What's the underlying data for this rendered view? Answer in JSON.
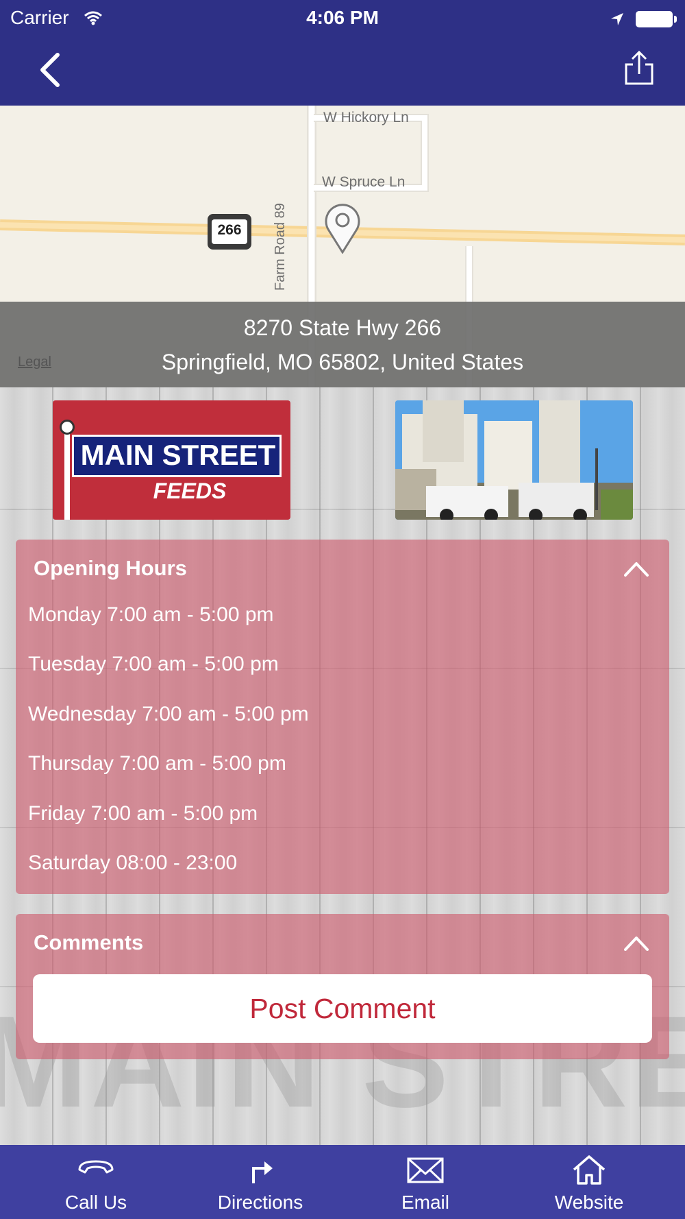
{
  "status_bar": {
    "carrier": "Carrier",
    "time": "4:06 PM"
  },
  "nav": {
    "back_icon": "chevron-left-icon",
    "share_icon": "share-icon"
  },
  "map": {
    "street_labels": [
      "W Hickory Ln",
      "W Spruce Ln",
      "Farm Road 89"
    ],
    "route_shield": "266",
    "address_line1": "8270 State Hwy 266",
    "address_line2": "Springfield, MO 65802, United States",
    "legal": "Legal"
  },
  "logo": {
    "line1": "MAIN STREET",
    "line2": "FEEDS"
  },
  "hours": {
    "title": "Opening Hours",
    "lines": [
      "Monday 7:00 am - 5:00 pm",
      "Tuesday 7:00 am - 5:00 pm",
      "Wednesday 7:00 am - 5:00 pm",
      "Thursday 7:00 am - 5:00 pm",
      "Friday 7:00 am - 5:00 pm",
      "Saturday 08:00 - 23:00"
    ]
  },
  "comments": {
    "title": "Comments",
    "post_button": "Post Comment"
  },
  "tabbar": {
    "items": [
      {
        "label": "Call Us",
        "icon": "phone-icon"
      },
      {
        "label": "Directions",
        "icon": "directions-arrow-icon"
      },
      {
        "label": "Email",
        "icon": "envelope-icon"
      },
      {
        "label": "Website",
        "icon": "home-icon"
      }
    ]
  },
  "colors": {
    "nav_bar": "#2e3086",
    "tab_bar": "#3f40a0",
    "panel": "#cd5a6c",
    "post_button_text": "#c0283a"
  }
}
